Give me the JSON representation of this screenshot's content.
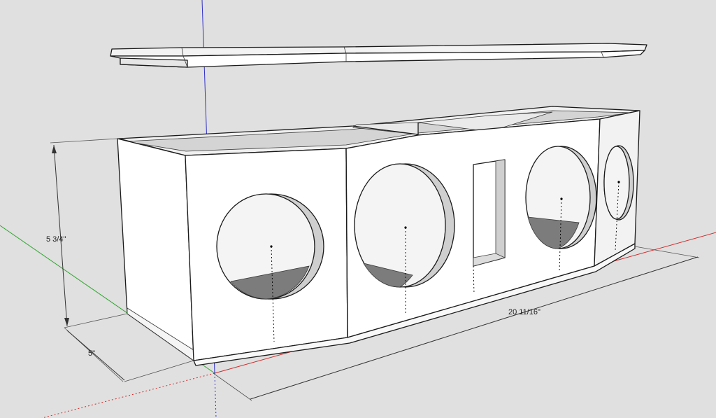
{
  "dimensions": {
    "height": "5 3/4\"",
    "depth": "5\"",
    "length": "20 11/16\""
  },
  "colors": {
    "background": "#e0e0e0",
    "face": "#ffffff",
    "shade": "#dcdcdc",
    "inner_floor": "#7c7c7c",
    "axis_red": "#d12b2b",
    "axis_green": "#2fa52f",
    "axis_blue": "#3030c8"
  },
  "model": {
    "parts": [
      "lid-panel",
      "enclosure-box",
      "port-slot",
      "speaker-cutouts"
    ],
    "speaker_cutouts": 4
  }
}
